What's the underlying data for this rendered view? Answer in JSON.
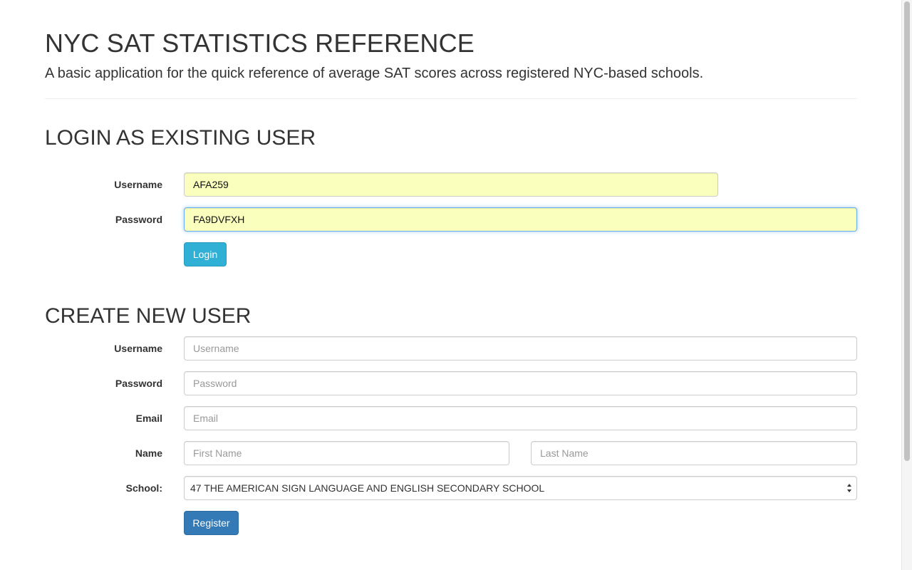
{
  "header": {
    "title": "NYC SAT STATISTICS REFERENCE",
    "lead": "A basic application for the quick reference of average SAT scores across registered NYC-based schools."
  },
  "login": {
    "heading": "LOGIN AS EXISTING USER",
    "username_label": "Username",
    "username_value": "AFA259",
    "password_label": "Password",
    "password_value": "FA9DVFXH",
    "button_label": "Login"
  },
  "register": {
    "heading": "CREATE NEW USER",
    "username_label": "Username",
    "username_placeholder": "Username",
    "password_label": "Password",
    "password_placeholder": "Password",
    "email_label": "Email",
    "email_placeholder": "Email",
    "name_label": "Name",
    "first_name_placeholder": "First Name",
    "last_name_placeholder": "Last Name",
    "school_label": "School:",
    "school_selected": "47 THE AMERICAN SIGN LANGUAGE AND ENGLISH SECONDARY SCHOOL",
    "button_label": "Register"
  },
  "colors": {
    "info": "#31b0d5",
    "primary": "#337ab7",
    "autofill": "#faffbd"
  }
}
